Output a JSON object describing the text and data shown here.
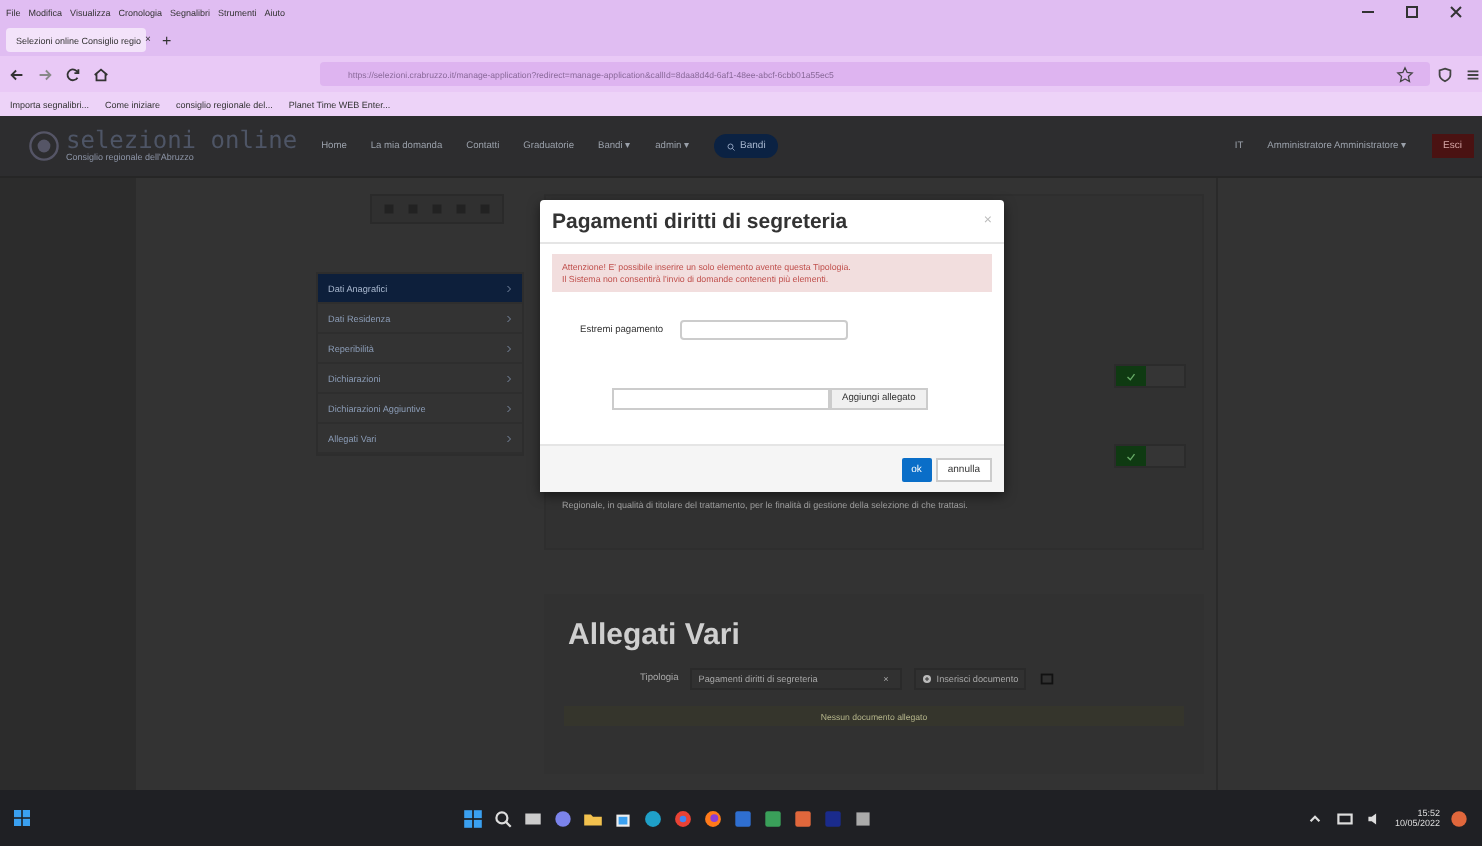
{
  "menu": [
    "File",
    "Modifica",
    "Visualizza",
    "Cronologia",
    "Segnalibri",
    "Strumenti",
    "Aiuto"
  ],
  "browser_tab": {
    "title": "Selezioni online Consiglio regio",
    "close": "×"
  },
  "new_tab": "+",
  "address_bar": {
    "url": "https://selezioni.crabruzzo.it/manage-application?redirect=manage-application&callId=8daa8d4d-6af1-48ee-abcf-6cbb01a55ec5"
  },
  "bookmarks": [
    "Importa segnalibri...",
    "Come iniziare",
    "consiglio regionale del...",
    "Planet Time WEB Enter..."
  ],
  "site": {
    "logo_title": "selezioni online",
    "logo_subtitle": "Consiglio regionale dell'Abruzzo",
    "nav": [
      "Home",
      "La mia domanda",
      "Contatti",
      "Graduatorie",
      "Bandi ▾",
      "admin ▾"
    ],
    "search_button": "Bandi",
    "language": "IT",
    "user": "Amministratore Amministratore ▾",
    "logout": "Esci"
  },
  "sidebar": [
    {
      "label": "Dati Anagrafici",
      "selected": true
    },
    {
      "label": "Dati Residenza",
      "selected": false
    },
    {
      "label": "Reperibilità",
      "selected": false
    },
    {
      "label": "Dichiarazioni",
      "selected": false
    },
    {
      "label": "Dichiarazioni Aggiuntive",
      "selected": false
    },
    {
      "label": "Allegati Vari",
      "selected": false
    }
  ],
  "consents": [
    {
      "checked": true
    },
    {
      "checked": true
    }
  ],
  "privacy_text": "Regionale, in qualità di titolare del trattamento, per le finalità di gestione della selezione di che trattasi.",
  "attachments": {
    "heading": "Allegati Vari",
    "type_label": "Tipologia",
    "type_value": "Pagamenti diritti di segreteria",
    "clear": "×",
    "insert_button": "Inserisci documento",
    "notice": "Nessun documento allegato"
  },
  "modal": {
    "title": "Pagamenti diritti di segreteria",
    "close": "×",
    "alert": [
      "Attenzione! E' possibile inserire un solo elemento avente questa Tipologia.",
      "Il Sistema non consentirà l'invio di domande contenenti più elementi."
    ],
    "field_label": "Estremi pagamento",
    "attach_button": "Aggiungi allegato",
    "ok": "ok",
    "cancel": "annulla"
  },
  "taskbar": {
    "time": "15:52",
    "date": "10/05/2022"
  }
}
